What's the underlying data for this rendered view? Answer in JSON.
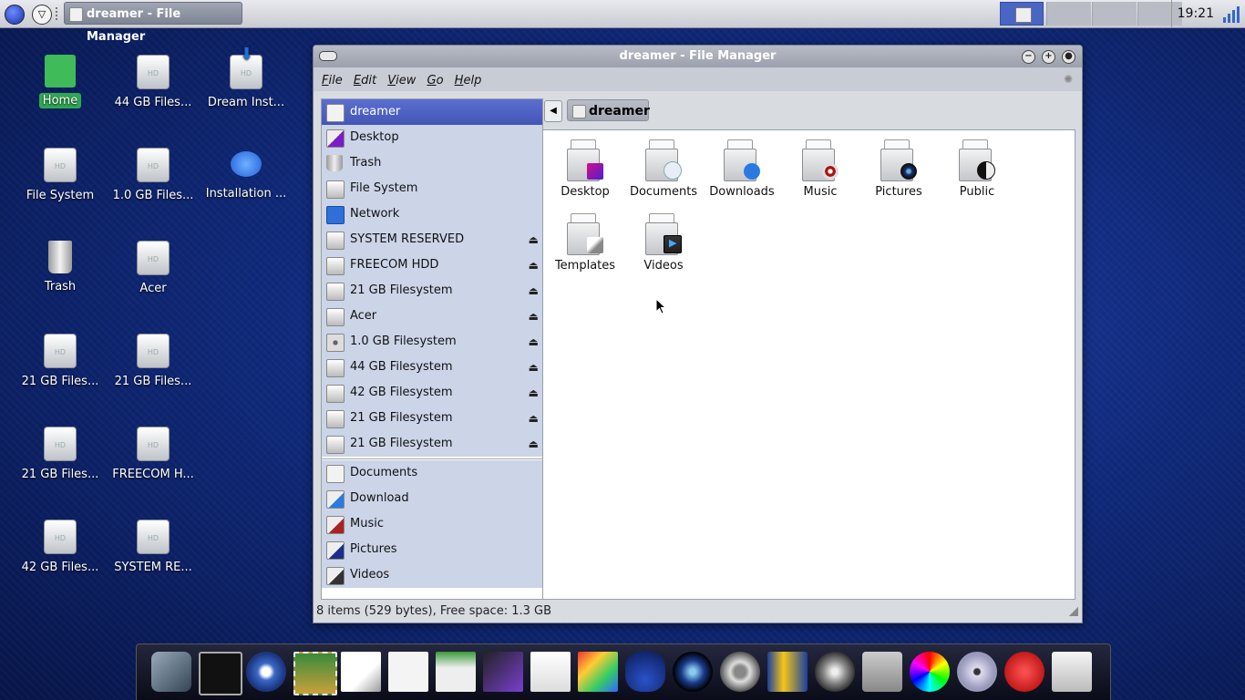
{
  "top_panel": {
    "task_title": "dreamer - File Manager",
    "clock": "19:21"
  },
  "desktop_icons": [
    {
      "label": "Home"
    },
    {
      "label": "44 GB Files..."
    },
    {
      "label": "Dream Inst..."
    },
    {
      "label": "File System"
    },
    {
      "label": "1.0 GB Files..."
    },
    {
      "label": "Installation ..."
    },
    {
      "label": "Trash"
    },
    {
      "label": "Acer"
    },
    {
      "label": "21 GB Files..."
    },
    {
      "label": "21 GB Files..."
    },
    {
      "label": "21 GB Files..."
    },
    {
      "label": "FREECOM H..."
    },
    {
      "label": "42 GB Files..."
    },
    {
      "label": "SYSTEM RE..."
    }
  ],
  "window": {
    "title": "dreamer - File Manager",
    "menu": [
      "File",
      "Edit",
      "View",
      "Go",
      "Help"
    ],
    "path_crumb": "dreamer",
    "sidebar": {
      "devices": [
        {
          "label": "dreamer",
          "eject": false
        },
        {
          "label": "Desktop",
          "eject": false
        },
        {
          "label": "Trash",
          "eject": false
        },
        {
          "label": "File System",
          "eject": false
        },
        {
          "label": "Network",
          "eject": false
        },
        {
          "label": "SYSTEM RESERVED",
          "eject": true
        },
        {
          "label": "FREECOM HDD",
          "eject": true
        },
        {
          "label": "21 GB Filesystem",
          "eject": true
        },
        {
          "label": "Acer",
          "eject": true
        },
        {
          "label": "1.0 GB Filesystem",
          "eject": true
        },
        {
          "label": "44 GB Filesystem",
          "eject": true
        },
        {
          "label": "42 GB Filesystem",
          "eject": true
        },
        {
          "label": "21 GB Filesystem",
          "eject": true
        },
        {
          "label": "21 GB Filesystem",
          "eject": true
        }
      ],
      "places": [
        {
          "label": "Documents"
        },
        {
          "label": "Download"
        },
        {
          "label": "Music"
        },
        {
          "label": "Pictures"
        },
        {
          "label": "Videos"
        }
      ]
    },
    "files": [
      {
        "label": "Desktop"
      },
      {
        "label": "Documents"
      },
      {
        "label": "Downloads"
      },
      {
        "label": "Music"
      },
      {
        "label": "Pictures"
      },
      {
        "label": "Public"
      },
      {
        "label": "Templates"
      },
      {
        "label": "Videos"
      }
    ],
    "status": "8 items (529 bytes), Free space: 1.3 GB"
  }
}
